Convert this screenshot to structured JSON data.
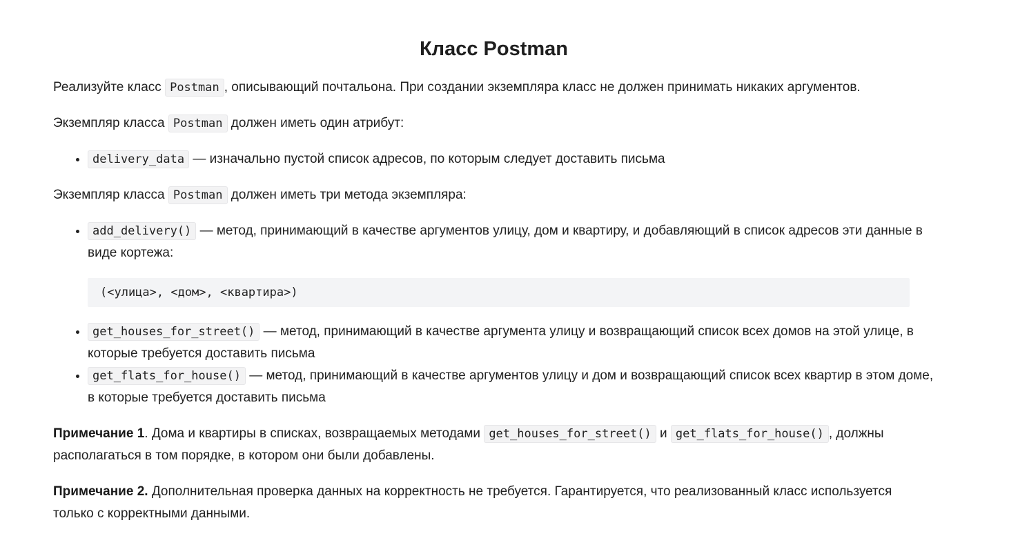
{
  "title": "Класс Postman",
  "p1": {
    "before": "Реализуйте класс ",
    "code": "Postman",
    "after": ", описывающий почтальона. При создании экземпляра класс не должен принимать никаких аргументов."
  },
  "p2": {
    "before": "Экземпляр класса ",
    "code": "Postman",
    "after": " должен иметь один атрибут:"
  },
  "attributes": [
    {
      "code": "delivery_data",
      "text": " — изначально пустой список адресов, по которым следует доставить письма"
    }
  ],
  "p3": {
    "before": "Экземпляр класса ",
    "code": "Postman",
    "after": " должен иметь три метода экземпляра:"
  },
  "methods": [
    {
      "code": "add_delivery()",
      "text": " — метод, принимающий в качестве аргументов улицу, дом и квартиру, и добавляющий в список адресов эти данные в виде кортежа:"
    },
    {
      "code": "get_houses_for_street()",
      "text": " — метод, принимающий в качестве аргумента улицу и возвращающий список всех домов на этой улице, в которые требуется доставить письма"
    },
    {
      "code": "get_flats_for_house()",
      "text": " — метод, принимающий в качестве аргументов улицу и дом и возвращающий список всех квартир в этом доме, в которые требуется доставить письма"
    }
  ],
  "codeblock": "(<улица>, <дом>, <квартира>)",
  "note1": {
    "label": "Примечание 1",
    "before": ". Дома и квартиры в списках, возвращаемых методами ",
    "code1": "get_houses_for_street()",
    "middle": " и ",
    "code2": "get_flats_for_house()",
    "after": ", должны располагаться в том порядке, в котором они были добавлены."
  },
  "note2": {
    "label": "Примечание 2.",
    "text": " Дополнительная проверка данных на корректность не требуется. Гарантируется, что реализованный класс используется только с корректными данными."
  }
}
